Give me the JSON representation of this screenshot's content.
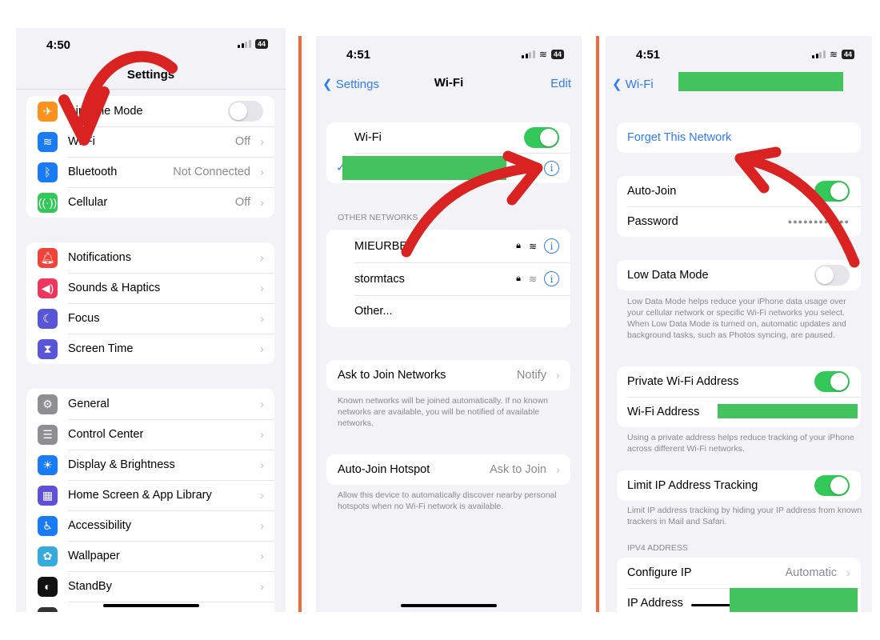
{
  "colors": {
    "accent": "#2f7cf6",
    "toggle_on": "#34c759",
    "arrow": "#d92323",
    "divider": "#f26a3c",
    "redaction": "#43c35d"
  },
  "panel1": {
    "time": "4:50",
    "battery": "44",
    "title": "Settings",
    "groups": [
      [
        {
          "icon": "airplane-icon",
          "color": "#f7931e",
          "glyph": "✈",
          "label": "Airplane Mode",
          "toggle": false
        },
        {
          "icon": "wifi-icon",
          "color": "#1a7cf5",
          "glyph": "≋",
          "label": "Wi-Fi",
          "value": "Off"
        },
        {
          "icon": "bluetooth-icon",
          "color": "#1a7cf5",
          "glyph": "ᛒ",
          "label": "Bluetooth",
          "value": "Not Connected"
        },
        {
          "icon": "cellular-icon",
          "color": "#34c759",
          "glyph": "((·))",
          "label": "Cellular",
          "value": "Off"
        }
      ],
      [
        {
          "icon": "notifications-icon",
          "color": "#f0443a",
          "glyph": "🔔︎",
          "label": "Notifications"
        },
        {
          "icon": "sounds-icon",
          "color": "#f0365e",
          "glyph": "◀)",
          "label": "Sounds & Haptics"
        },
        {
          "icon": "focus-icon",
          "color": "#5856d6",
          "glyph": "☾",
          "label": "Focus"
        },
        {
          "icon": "screen-time-icon",
          "color": "#5856d6",
          "glyph": "⧗",
          "label": "Screen Time"
        }
      ],
      [
        {
          "icon": "general-icon",
          "color": "#8e8e93",
          "glyph": "⚙",
          "label": "General"
        },
        {
          "icon": "control-center-icon",
          "color": "#8e8e93",
          "glyph": "☰",
          "label": "Control Center"
        },
        {
          "icon": "display-brightness-icon",
          "color": "#1a7cf5",
          "glyph": "☀",
          "label": "Display & Brightness"
        },
        {
          "icon": "home-screen-icon",
          "color": "#5e50d8",
          "glyph": "▦",
          "label": "Home Screen & App Library"
        },
        {
          "icon": "accessibility-icon",
          "color": "#1a7cf5",
          "glyph": "♿︎",
          "label": "Accessibility"
        },
        {
          "icon": "wallpaper-icon",
          "color": "#35aadc",
          "glyph": "✿",
          "label": "Wallpaper"
        },
        {
          "icon": "standby-icon",
          "color": "#111111",
          "glyph": "◐",
          "label": "StandBy"
        },
        {
          "icon": "partial-icon",
          "color": "#333333",
          "glyph": "",
          "label": ""
        }
      ]
    ]
  },
  "panel2": {
    "time": "4:51",
    "battery": "44",
    "back": "Settings",
    "title": "Wi-Fi",
    "edit": "Edit",
    "wifi_label": "Wi-Fi",
    "wifi_on": true,
    "other_header": "OTHER NETWORKS",
    "networks": [
      {
        "name": "MIEURBEI",
        "lock": true
      },
      {
        "name": "stormtacs",
        "lock": true
      }
    ],
    "other": "Other...",
    "ask_label": "Ask to Join Networks",
    "ask_value": "Notify",
    "ask_footer": "Known networks will be joined automatically. If no known networks are available, you will be notified of available networks.",
    "hotspot_label": "Auto-Join Hotspot",
    "hotspot_value": "Ask to Join",
    "hotspot_footer": "Allow this device to automatically discover nearby personal hotspots when no Wi-Fi network is available."
  },
  "panel3": {
    "time": "4:51",
    "battery": "44",
    "back": "Wi-Fi",
    "forget": "Forget This Network",
    "autojoin": "Auto-Join",
    "autojoin_on": true,
    "password": "Password",
    "password_mask": "●●●●●●●●●●●●",
    "lowdata": "Low Data Mode",
    "lowdata_on": false,
    "lowdata_footer": "Low Data Mode helps reduce your iPhone data usage over your cellular network or specific Wi-Fi networks you select. When Low Data Mode is turned on, automatic updates and background tasks, such as Photos syncing, are paused.",
    "private": "Private Wi-Fi Address",
    "private_on": true,
    "wifi_address": "Wi-Fi Address",
    "private_footer": "Using a private address helps reduce tracking of your iPhone across different Wi-Fi networks.",
    "limit": "Limit IP Address Tracking",
    "limit_on": true,
    "limit_footer": "Limit IP address tracking by hiding your IP address from known trackers in Mail and Safari.",
    "ipv4_header": "IPV4 ADDRESS",
    "configure": "Configure IP",
    "configure_value": "Automatic",
    "ip": "IP Address"
  }
}
